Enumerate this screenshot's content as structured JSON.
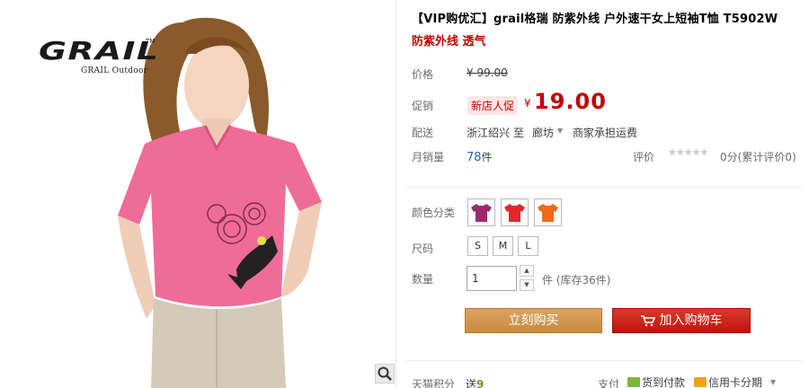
{
  "product": {
    "title": "【VIP购优汇】grail格瑞 防紫外线 户外速干女上短袖T恤 T5902W",
    "subtitle": "防紫外线 透气"
  },
  "logo": {
    "brand": "GRAIL",
    "tm": "TM",
    "tagline": "GRAIL Outdoor"
  },
  "price": {
    "label": "价格",
    "original": "¥ 99.00"
  },
  "promo": {
    "label": "促销",
    "tag": "新店人促",
    "currency": "¥",
    "price": "19.00"
  },
  "shipping": {
    "label": "配送",
    "from": "浙江绍兴",
    "to_word": "至",
    "to": "廊坊",
    "fee": "商家承担运费"
  },
  "sales": {
    "label": "月销量",
    "count": "78",
    "unit": "件",
    "rating_label": "评价",
    "stars": "★★★★★",
    "rating_text": "0分(累计评价0)"
  },
  "colors": {
    "label": "颜色分类",
    "options": [
      {
        "name": "purple-tee",
        "color": "#9b2a6b"
      },
      {
        "name": "red-tee",
        "color": "#e3262b"
      },
      {
        "name": "orange-tee",
        "color": "#f26a1a"
      }
    ]
  },
  "sizes": {
    "label": "尺码",
    "options": [
      "S",
      "M",
      "L"
    ]
  },
  "quantity": {
    "label": "数量",
    "value": "1",
    "unit_text": "件 (库存36件)"
  },
  "actions": {
    "buy_now": "立刻购买",
    "add_cart": "加入购物车"
  },
  "footer": {
    "points_label": "天猫积分",
    "points_prefix": "送",
    "points_value": "9",
    "pay_label": "支付",
    "cod": "货到付款",
    "installment": "信用卡分期"
  }
}
